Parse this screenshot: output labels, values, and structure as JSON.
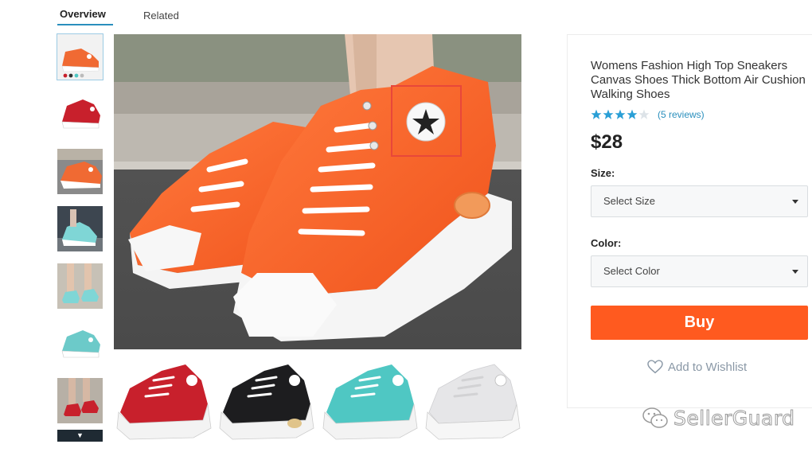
{
  "tabs": [
    {
      "label": "Overview",
      "active": true
    },
    {
      "label": "Related",
      "active": false
    }
  ],
  "thumbnails": [
    {
      "color": "orange"
    },
    {
      "color": "red"
    },
    {
      "color": "orange"
    },
    {
      "color": "teal"
    },
    {
      "color": "teal"
    },
    {
      "color": "teal"
    },
    {
      "color": "red"
    }
  ],
  "thumbnail_scroll_icon": "chevron-down-icon",
  "thumbnail_scroll_glyph": "▼",
  "main_image": {
    "color": "orange",
    "highlight_color": "#e8473a"
  },
  "variants": [
    {
      "color": "red",
      "hex": "#c8202c"
    },
    {
      "color": "black",
      "hex": "#1d1d1f"
    },
    {
      "color": "teal",
      "hex": "#4fc7c3"
    },
    {
      "color": "white",
      "hex": "#e6e6e8"
    }
  ],
  "product": {
    "title": "Womens Fashion High Top Sneakers Canvas Shoes Thick Bottom Air Cushion Walking Shoes",
    "rating": 4,
    "rating_max": 5,
    "reviews_label": "(5 reviews)",
    "price": "$28"
  },
  "size": {
    "label": "Size:",
    "placeholder": "Select Size"
  },
  "color": {
    "label": "Color:",
    "placeholder": "Select Color"
  },
  "buy_label": "Buy",
  "wishlist_label": "Add to Wishlist",
  "watermark": {
    "text": "SellerGuard",
    "icon": "wechat-icon"
  },
  "colors": {
    "accent": "#2a8fbd",
    "buy": "#ff5a1f",
    "star": "#2a9fd6",
    "star_empty": "#dde3e8"
  }
}
